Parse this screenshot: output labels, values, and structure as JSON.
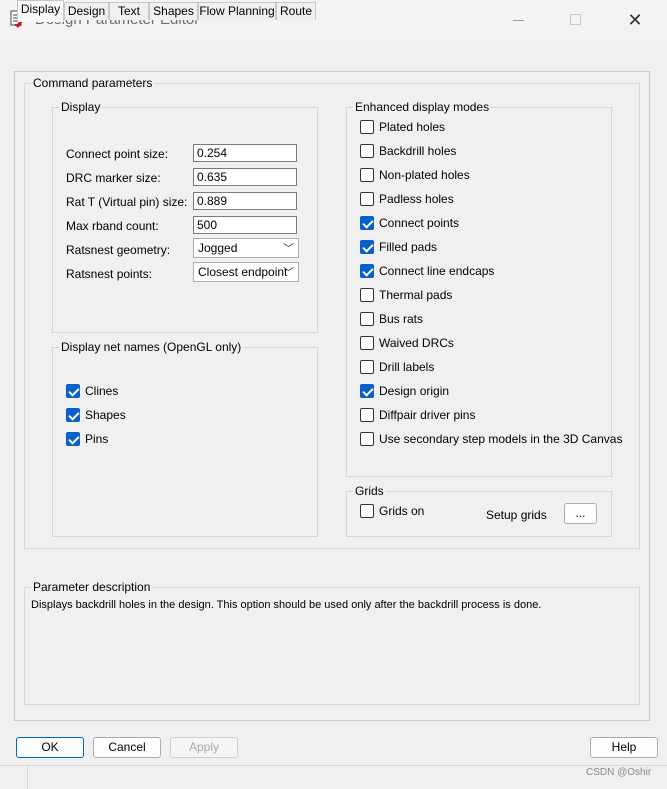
{
  "window": {
    "title": "Design Parameter Editor"
  },
  "tabs": [
    "Display",
    "Design",
    "Text",
    "Shapes",
    "Flow Planning",
    "Route"
  ],
  "command_group": "Command parameters",
  "display": {
    "label": "Display",
    "fields": [
      {
        "label": "Connect point size:",
        "value": "0.254"
      },
      {
        "label": "DRC marker size:",
        "value": "0.635"
      },
      {
        "label": "Rat T (Virtual pin) size:",
        "value": "0.889"
      },
      {
        "label": "Max rband count:",
        "value": "500"
      }
    ],
    "ratsnest_geometry": {
      "label": "Ratsnest geometry:",
      "value": "Jogged"
    },
    "ratsnest_points": {
      "label": "Ratsnest points:",
      "value": "Closest endpoint"
    }
  },
  "net_names": {
    "label": "Display net names (OpenGL only)",
    "items": [
      {
        "label": "Clines",
        "checked": true
      },
      {
        "label": "Shapes",
        "checked": true
      },
      {
        "label": "Pins",
        "checked": true
      }
    ]
  },
  "enhanced": {
    "label": "Enhanced display modes",
    "items": [
      {
        "label": "Plated holes",
        "checked": false
      },
      {
        "label": "Backdrill holes",
        "checked": false
      },
      {
        "label": "Non-plated holes",
        "checked": false
      },
      {
        "label": "Padless holes",
        "checked": false
      },
      {
        "label": "Connect points",
        "checked": true
      },
      {
        "label": "Filled pads",
        "checked": true
      },
      {
        "label": "Connect line endcaps",
        "checked": true
      },
      {
        "label": "Thermal pads",
        "checked": false
      },
      {
        "label": "Bus rats",
        "checked": false
      },
      {
        "label": "Waived DRCs",
        "checked": false
      },
      {
        "label": "Drill labels",
        "checked": false
      },
      {
        "label": "Design origin",
        "checked": true
      },
      {
        "label": "Diffpair driver pins",
        "checked": false
      },
      {
        "label": "Use secondary step models in the 3D Canvas",
        "checked": false
      }
    ]
  },
  "grids": {
    "label": "Grids",
    "grids_on": {
      "label": "Grids on",
      "checked": false
    },
    "setup_label": "Setup grids",
    "setup_button": "..."
  },
  "param_desc": {
    "label": "Parameter description",
    "text": "Displays backdrill holes in the design. This option should be used only after the backdrill process is done."
  },
  "buttons": {
    "ok": "OK",
    "cancel": "Cancel",
    "apply": "Apply",
    "help": "Help"
  },
  "watermark": "CSDN @Oshir",
  "colors": {
    "accent": "#0a5fc8",
    "background": "#f0f0f0"
  }
}
